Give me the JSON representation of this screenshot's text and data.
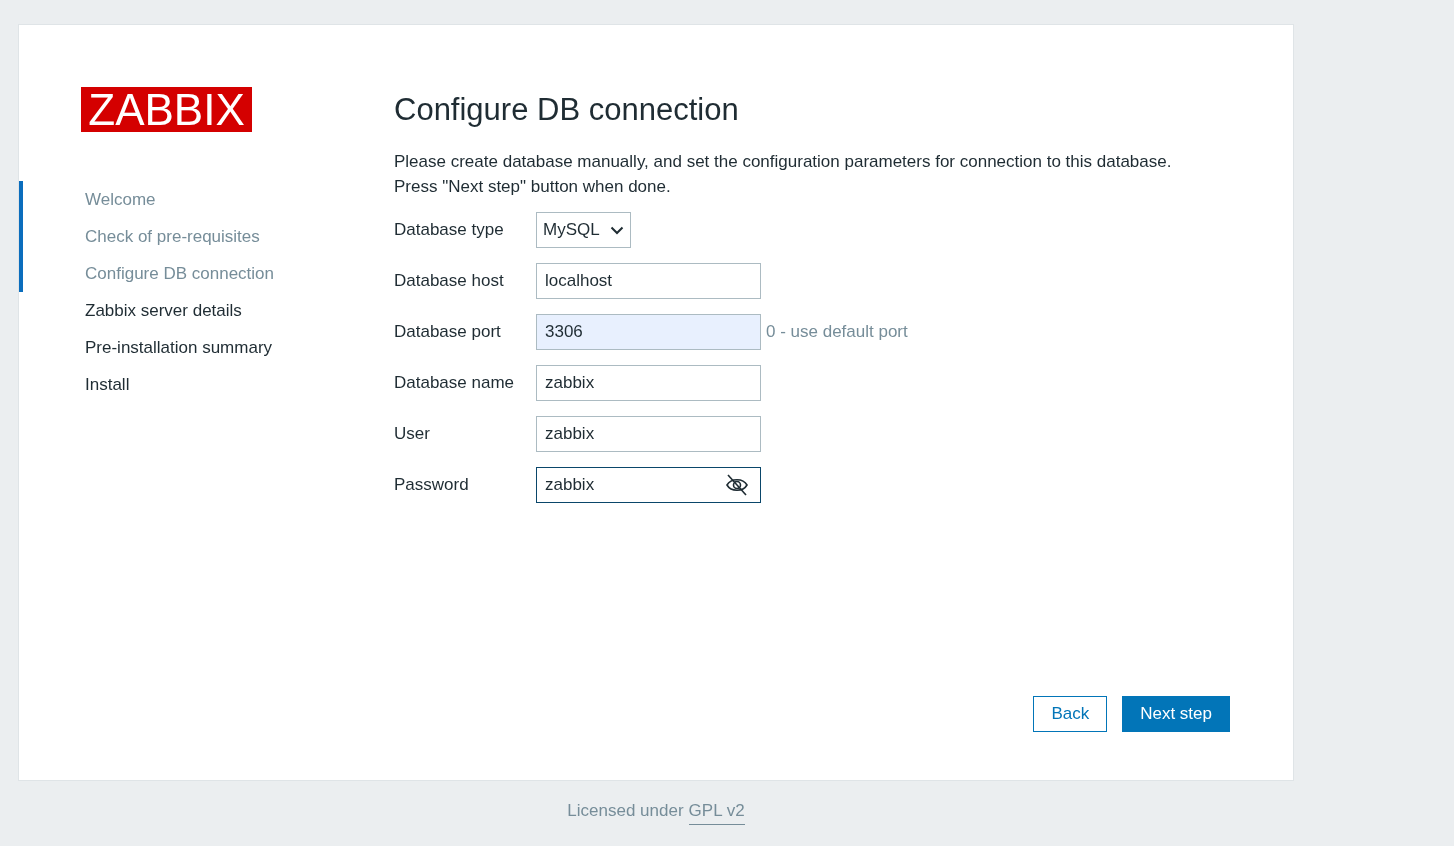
{
  "logo": {
    "text": "ZABBIX"
  },
  "steps": [
    {
      "label": "Welcome",
      "completed": true
    },
    {
      "label": "Check of pre-requisites",
      "completed": true
    },
    {
      "label": "Configure DB connection",
      "completed": true
    },
    {
      "label": "Zabbix server details",
      "completed": false
    },
    {
      "label": "Pre-installation summary",
      "completed": false
    },
    {
      "label": "Install",
      "completed": false
    }
  ],
  "title": "Configure DB connection",
  "description": [
    "Please create database manually, and set the configuration parameters for connection to this database.",
    "Press \"Next step\" button when done."
  ],
  "fields": [
    {
      "kind": "select",
      "label": "Database type",
      "value": "MySQL",
      "autofilled": false,
      "focused": false
    },
    {
      "kind": "text",
      "label": "Database host",
      "value": "localhost",
      "autofilled": false,
      "focused": false
    },
    {
      "kind": "text",
      "label": "Database port",
      "value": "3306",
      "hint": "0 - use default port",
      "autofilled": true,
      "focused": false
    },
    {
      "kind": "text",
      "label": "Database name",
      "value": "zabbix",
      "autofilled": false,
      "focused": false
    },
    {
      "kind": "text",
      "label": "User",
      "value": "zabbix",
      "autofilled": false,
      "focused": false
    },
    {
      "kind": "password",
      "label": "Password",
      "value": "zabbix",
      "autofilled": false,
      "focused": true
    }
  ],
  "buttons": [
    {
      "label": "Back",
      "kind": "secondary"
    },
    {
      "label": "Next step",
      "kind": "primary"
    }
  ],
  "footer": {
    "text": "Licensed under",
    "link": "GPL v2"
  }
}
